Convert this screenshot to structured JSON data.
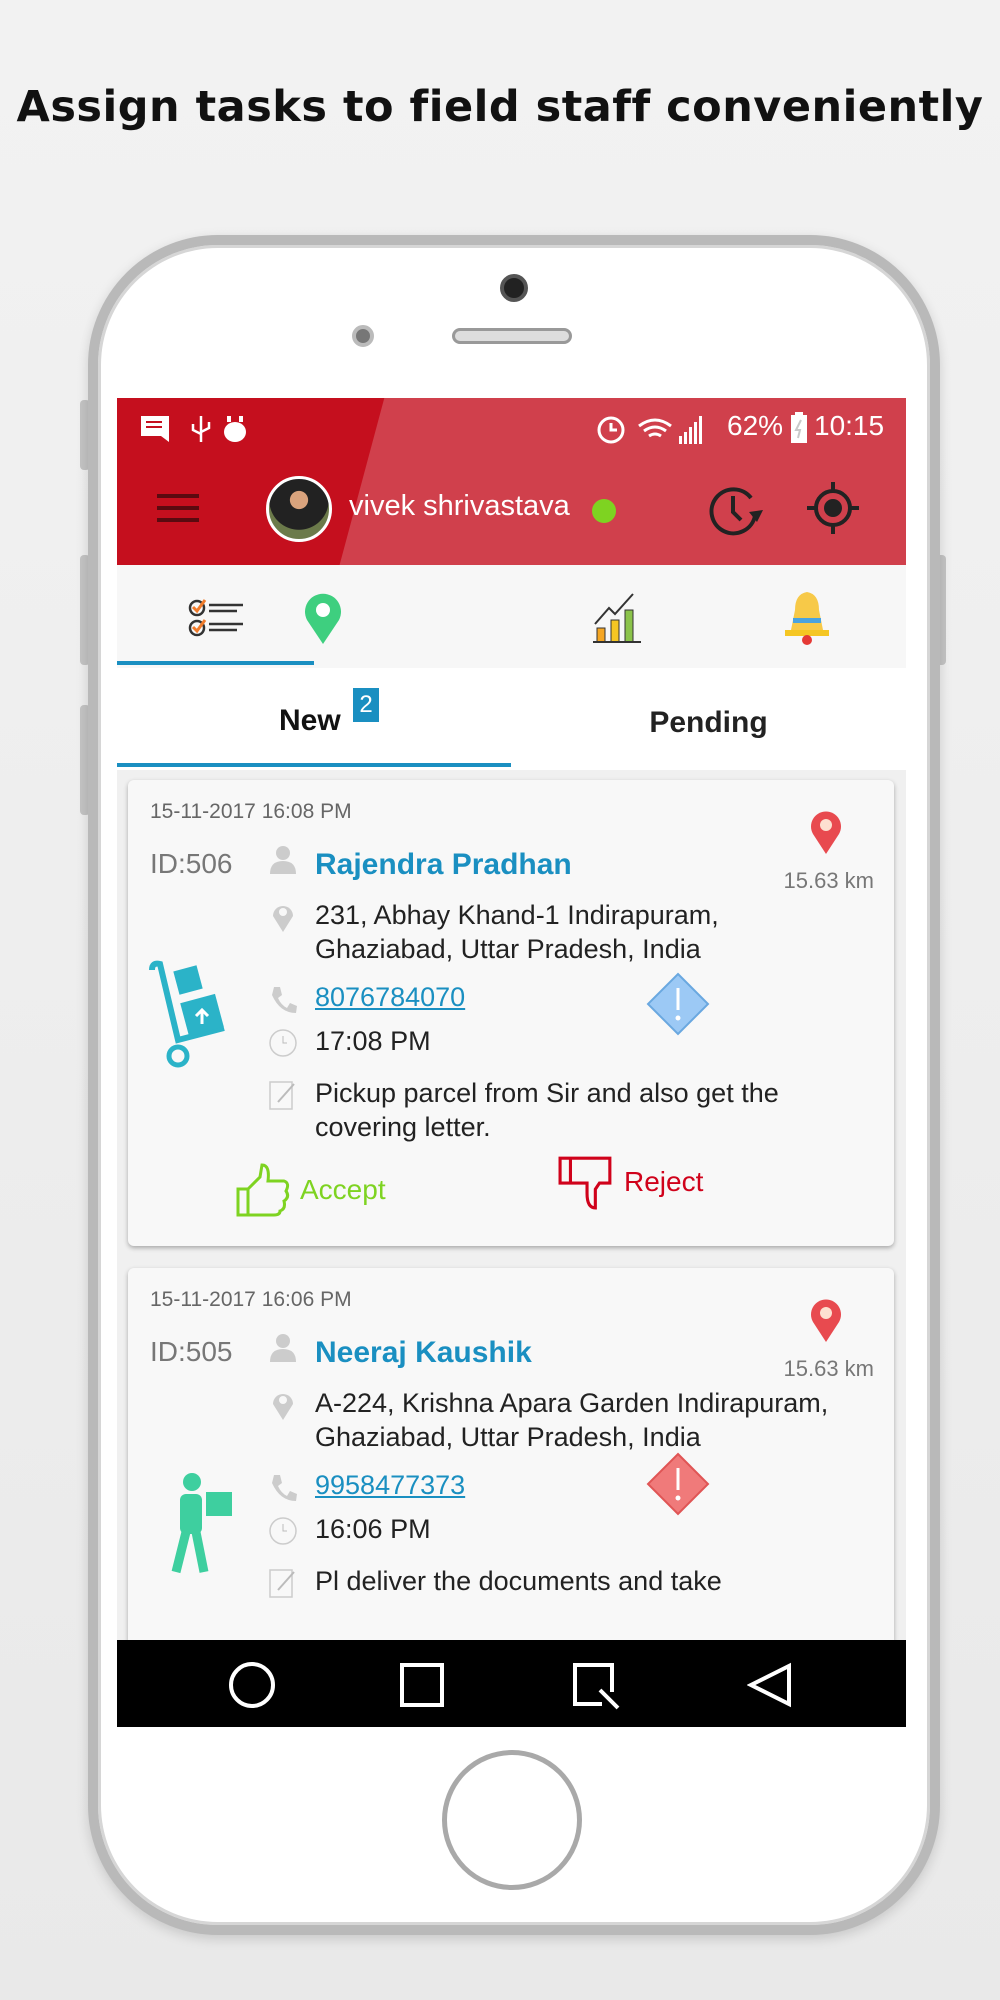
{
  "headline": "Assign tasks to field staff conveniently",
  "status_bar": {
    "battery": "62%",
    "time": "10:15",
    "icons": [
      "message-icon",
      "usb-icon",
      "android-debug-icon",
      "alarm-icon",
      "wifi-icon",
      "signal-icon",
      "battery-charging-icon"
    ]
  },
  "app_bar": {
    "user_name": "vivek shrivastava",
    "online_color": "#7ed321",
    "brand_color": "#c50f1e"
  },
  "icon_tabs": [
    {
      "icon": "task-list-icon",
      "active": true
    },
    {
      "icon": "map-pin-icon"
    },
    {
      "icon": "growth-chart-icon"
    },
    {
      "icon": "bell-icon"
    }
  ],
  "sub_tabs": {
    "new_label": "New",
    "new_count": "2",
    "pending_label": "Pending"
  },
  "tasks": [
    {
      "date": "15-11-2017 16:08 PM",
      "id": "ID:506",
      "name": "Rajendra Pradhan",
      "distance": "15.63 km",
      "address": "231, Abhay Khand-1  Indirapuram, Ghaziabad, Uttar Pradesh, India",
      "phone": "8076784070",
      "time": "17:08 PM",
      "note": "Pickup parcel from Sir and also get the covering letter.",
      "accept": "Accept",
      "reject": "Reject",
      "type_icon": "pickup-trolley-icon",
      "priority_color": "#9cc9f5"
    },
    {
      "date": "15-11-2017 16:06 PM",
      "id": "ID:505",
      "name": "Neeraj Kaushik",
      "distance": "15.63 km",
      "address": "A-224, Krishna Apara Garden Indirapuram, Ghaziabad, Uttar Pradesh, India",
      "phone": "9958477373",
      "time": "16:06 PM",
      "note": "Pl deliver the documents and take",
      "type_icon": "delivery-man-icon",
      "priority_color": "#f07a7a"
    }
  ]
}
